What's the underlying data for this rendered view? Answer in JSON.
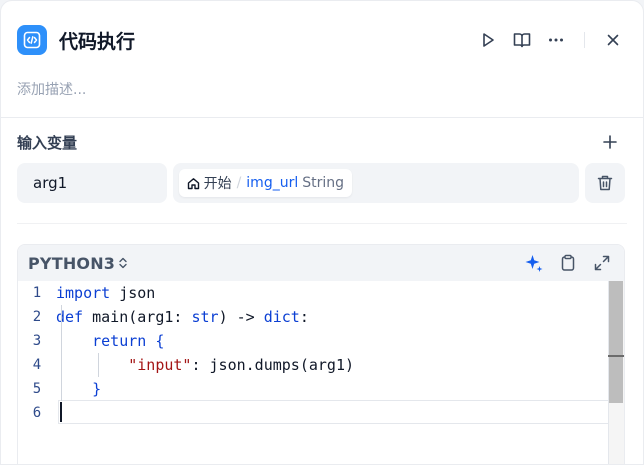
{
  "header": {
    "title": "代码执行",
    "description_placeholder": "添加描述..."
  },
  "input_variables": {
    "title": "输入变量",
    "items": [
      {
        "name": "arg1",
        "ref_node": "开始",
        "ref_separator": "/",
        "ref_variable": "img_url",
        "ref_type": "String"
      }
    ]
  },
  "editor": {
    "language": "PYTHON3",
    "line_numbers": [
      "1",
      "2",
      "3",
      "4",
      "5",
      "6"
    ],
    "lines": [
      "import json",
      "def main(arg1: str) -> dict:",
      "    return {",
      "        \"input\": json.dumps(arg1)",
      "    }",
      ""
    ]
  },
  "icons": {
    "app": "code-icon",
    "run": "play-icon",
    "docs": "book-open-icon",
    "more": "more-horizontal-icon",
    "close": "close-icon",
    "add": "plus-icon",
    "delete": "trash-icon",
    "ai": "sparkle-icon",
    "copy": "clipboard-icon",
    "expand": "expand-icon"
  },
  "colors": {
    "accent": "#2e90fa",
    "variable_link": "#155eef",
    "keyword": "#0b3fd3",
    "string": "#a31515"
  }
}
